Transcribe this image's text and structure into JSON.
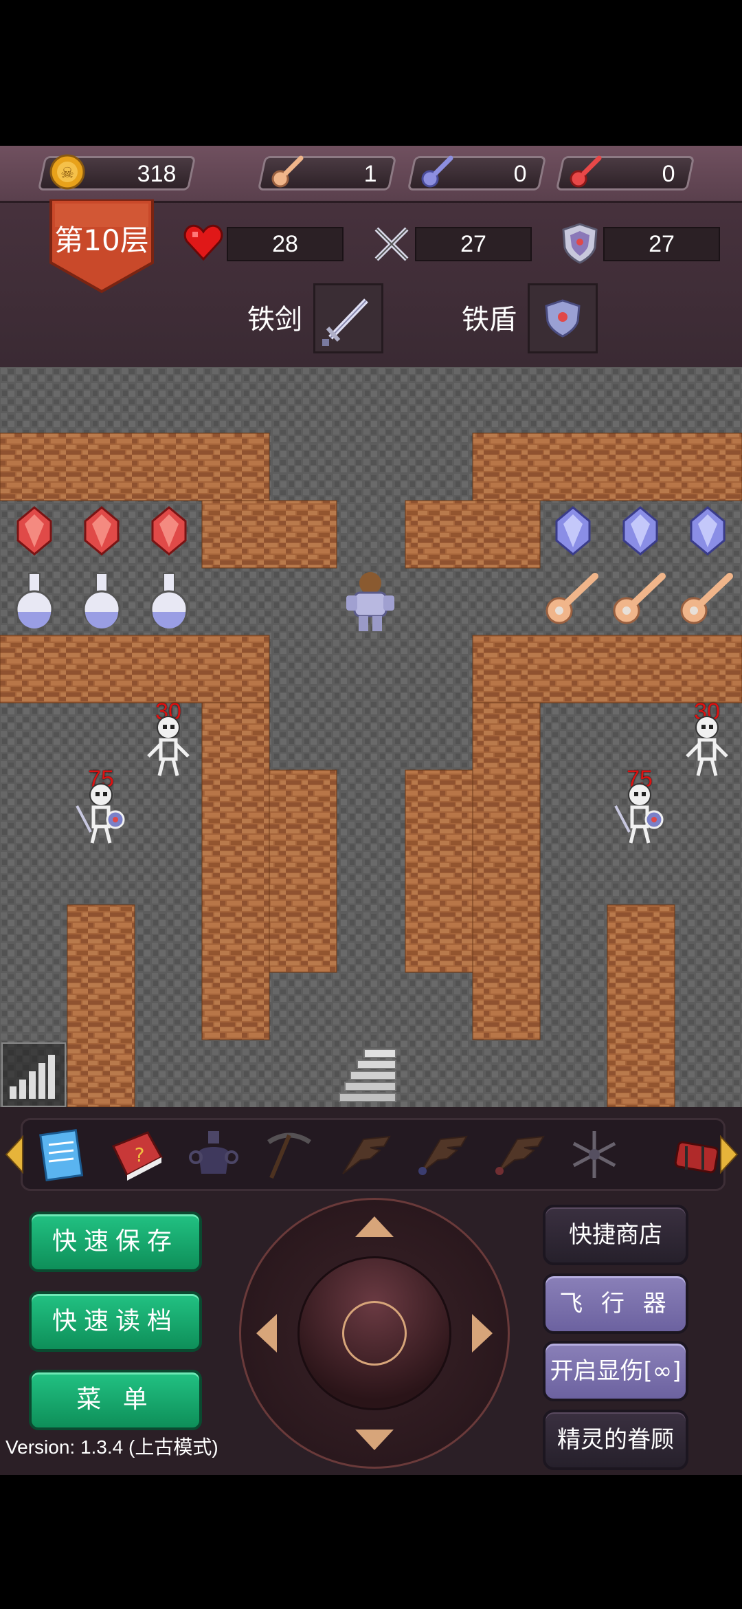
{
  "resources": {
    "gold": "318",
    "yellow_keys": "1",
    "blue_keys": "0",
    "red_keys": "0"
  },
  "floor": {
    "label": "第10层"
  },
  "stats": {
    "hp": "28",
    "attack": "27",
    "defense": "27"
  },
  "equipment": {
    "weapon_label": "铁剑",
    "shield_label": "铁盾"
  },
  "monsters": {
    "skeleton_hp": "30",
    "skeleton_captain_hp": "75"
  },
  "items": [
    "notepad-icon",
    "monster-book-icon",
    "holy-water-icon",
    "pickaxe-icon",
    "upstairs-wing-icon",
    "downstairs-wing-icon",
    "center-fly-icon",
    "snowflake-icon",
    "bomb-icon"
  ],
  "buttons": {
    "quick_save": "快速保存",
    "quick_load": "快速读档",
    "menu": "菜 单",
    "quick_shop": "快捷商店",
    "fly": "飞 行 器",
    "show_damage": "开启显伤[∞]",
    "fairy_favor": "精灵的眷顾"
  },
  "version": "Version: 1.3.4 (上古模式)",
  "colors": {
    "wall": "#a8653a",
    "floor": "#5a5a5a",
    "green_button": "#1aa870",
    "purple_button": "#7a70ad"
  }
}
